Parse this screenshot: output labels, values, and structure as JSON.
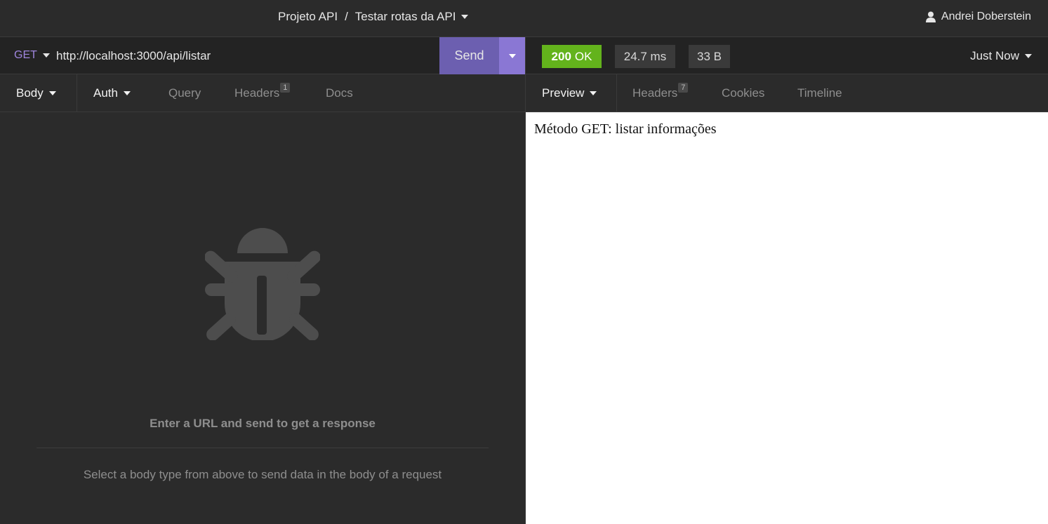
{
  "header": {
    "project": "Projeto API",
    "separator": "/",
    "collection": "Testar rotas da API",
    "user_name": "Andrei Doberstein"
  },
  "request": {
    "method": "GET",
    "url": "http://localhost:3000/api/listar",
    "send_label": "Send",
    "tabs": [
      {
        "label": "Body",
        "active": true
      },
      {
        "label": "Auth",
        "active": true
      },
      {
        "label": "Query",
        "active": false
      },
      {
        "label": "Headers",
        "badge": "1",
        "active": false
      },
      {
        "label": "Docs",
        "active": false
      }
    ],
    "empty": {
      "title": "Enter a URL and send to get a response",
      "subtitle": "Select a body type from above to send data in the body of a request"
    }
  },
  "response": {
    "status_code": "200",
    "status_text": "OK",
    "time": "24.7 ms",
    "size": "33 B",
    "history": "Just Now",
    "tabs": [
      {
        "label": "Preview",
        "active": true
      },
      {
        "label": "Headers",
        "badge": "7",
        "active": false
      },
      {
        "label": "Cookies",
        "active": false
      },
      {
        "label": "Timeline",
        "active": false
      }
    ],
    "preview_text": "Método GET: listar informações"
  },
  "colors": {
    "accent": "#6c5fb0",
    "accent_light": "#8a77d4",
    "status_ok": "#63b31c",
    "method": "#9f86dd",
    "background": "#2b2b2b"
  },
  "icons": [
    "chevron-down-icon",
    "user-icon",
    "bug-icon"
  ]
}
